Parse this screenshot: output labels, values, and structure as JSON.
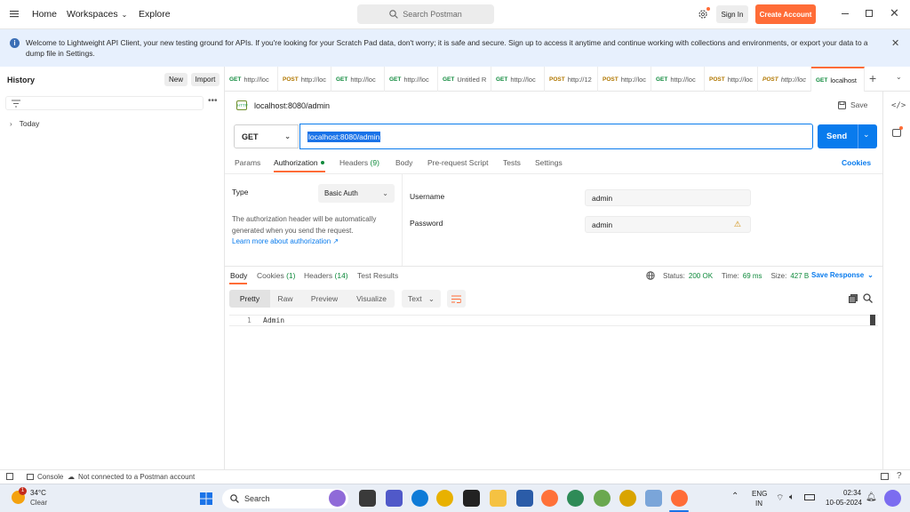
{
  "topbar": {
    "home": "Home",
    "workspaces": "Workspaces",
    "explore": "Explore",
    "search_placeholder": "Search Postman",
    "sign_in": "Sign In",
    "create_account": "Create Account"
  },
  "banner": {
    "message": "Welcome to Lightweight API Client, your new testing ground for APIs. If you're looking for your Scratch Pad data, don't worry; it is safe and secure. Sign up to access it anytime and continue working with collections and environments, or export your data to a dump file in Settings."
  },
  "history": {
    "title": "History",
    "new_label": "New",
    "import_label": "Import",
    "groups": [
      "Today"
    ]
  },
  "tabs": [
    {
      "method": "GET",
      "label": "http://loc"
    },
    {
      "method": "POST",
      "label": "http://loc"
    },
    {
      "method": "GET",
      "label": "http://loc"
    },
    {
      "method": "GET",
      "label": "http://loc"
    },
    {
      "method": "GET",
      "label": "Untitled R"
    },
    {
      "method": "GET",
      "label": "http://loc"
    },
    {
      "method": "POST",
      "label": "http://12"
    },
    {
      "method": "POST",
      "label": "http://loc"
    },
    {
      "method": "GET",
      "label": "http://loc"
    },
    {
      "method": "POST",
      "label": "http://loc"
    },
    {
      "method": "POST",
      "label": "http://loc"
    },
    {
      "method": "GET",
      "label": "localhost"
    }
  ],
  "request": {
    "name": "localhost:8080/admin",
    "save_label": "Save",
    "method": "GET",
    "url": "localhost:8080/admin",
    "send_label": "Send",
    "subtabs": [
      "Params",
      "Authorization",
      "Headers",
      "Body",
      "Pre-request Script",
      "Tests",
      "Settings"
    ],
    "headers_count": "(9)",
    "cookies_label": "Cookies"
  },
  "auth": {
    "type_label": "Type",
    "type_value": "Basic Auth",
    "description": "The authorization header will be automatically generated when you send the request.",
    "learn_more": "Learn more about authorization ↗",
    "username_label": "Username",
    "username_value": "admin",
    "password_label": "Password",
    "password_value": "admin"
  },
  "response": {
    "tabs": [
      "Body",
      "Cookies",
      "Headers",
      "Test Results"
    ],
    "cookies_count": "(1)",
    "headers_count": "(14)",
    "status_label": "Status:",
    "status_value": "200 OK",
    "time_label": "Time:",
    "time_value": "69 ms",
    "size_label": "Size:",
    "size_value": "427 B",
    "save_response": "Save Response",
    "view_modes": [
      "Pretty",
      "Raw",
      "Preview",
      "Visualize"
    ],
    "format": "Text",
    "line_number": "1",
    "body_text": "Admin"
  },
  "statusbar": {
    "console": "Console",
    "connection": "Not connected to a Postman account"
  },
  "taskbar": {
    "temperature": "34°C",
    "weather": "Clear",
    "weather_badge": "1",
    "search_label": "Search",
    "lang_line1": "ENG",
    "lang_line2": "IN",
    "time": "02:34",
    "date": "10-05-2024"
  },
  "colors": {
    "accent": "#ff6c37",
    "primary": "#097bed",
    "get": "#0f8a3c",
    "post": "#b17700",
    "status_ok": "#0f8a3c"
  }
}
